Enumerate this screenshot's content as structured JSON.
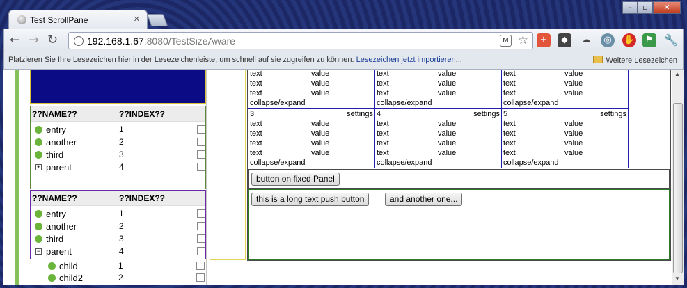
{
  "browser": {
    "tab_title": "Test ScrollPane",
    "url_host": "192.168.1.67",
    "url_rest": ":8080/TestSizeAware",
    "ext_label": "M",
    "bookmarks_msg": "Platzieren Sie Ihre Lesezeichen hier in der Lesezeichenleiste, um schnell auf sie zugreifen zu können.",
    "bookmarks_link": "Lesezeichen jetzt importieren...",
    "other_bookmarks": "Weitere Lesezeichen"
  },
  "tree1": {
    "col_name": "??NAME??",
    "col_index": "??INDEX??",
    "rows": [
      {
        "name": "entry",
        "index": "1"
      },
      {
        "name": "another",
        "index": "2"
      },
      {
        "name": "third",
        "index": "3"
      },
      {
        "name": "parent",
        "index": "4"
      }
    ]
  },
  "tree2": {
    "col_name": "??NAME??",
    "col_index": "??INDEX??",
    "rows": [
      {
        "name": "entry",
        "index": "1"
      },
      {
        "name": "another",
        "index": "2"
      },
      {
        "name": "third",
        "index": "3"
      },
      {
        "name": "parent",
        "index": "4"
      },
      {
        "name": "child",
        "index": "1"
      },
      {
        "name": "child2",
        "index": "2"
      }
    ]
  },
  "cards": {
    "text": "text",
    "value": "value",
    "collapse": "collapse/expand",
    "settings": "settings",
    "top_ids": [
      "",
      "",
      ""
    ],
    "bottom_ids": [
      "3",
      "4",
      "5"
    ]
  },
  "buttons": {
    "fixed": "button on fixed Panel",
    "long": "this is a long text push button",
    "another": "and another one..."
  }
}
